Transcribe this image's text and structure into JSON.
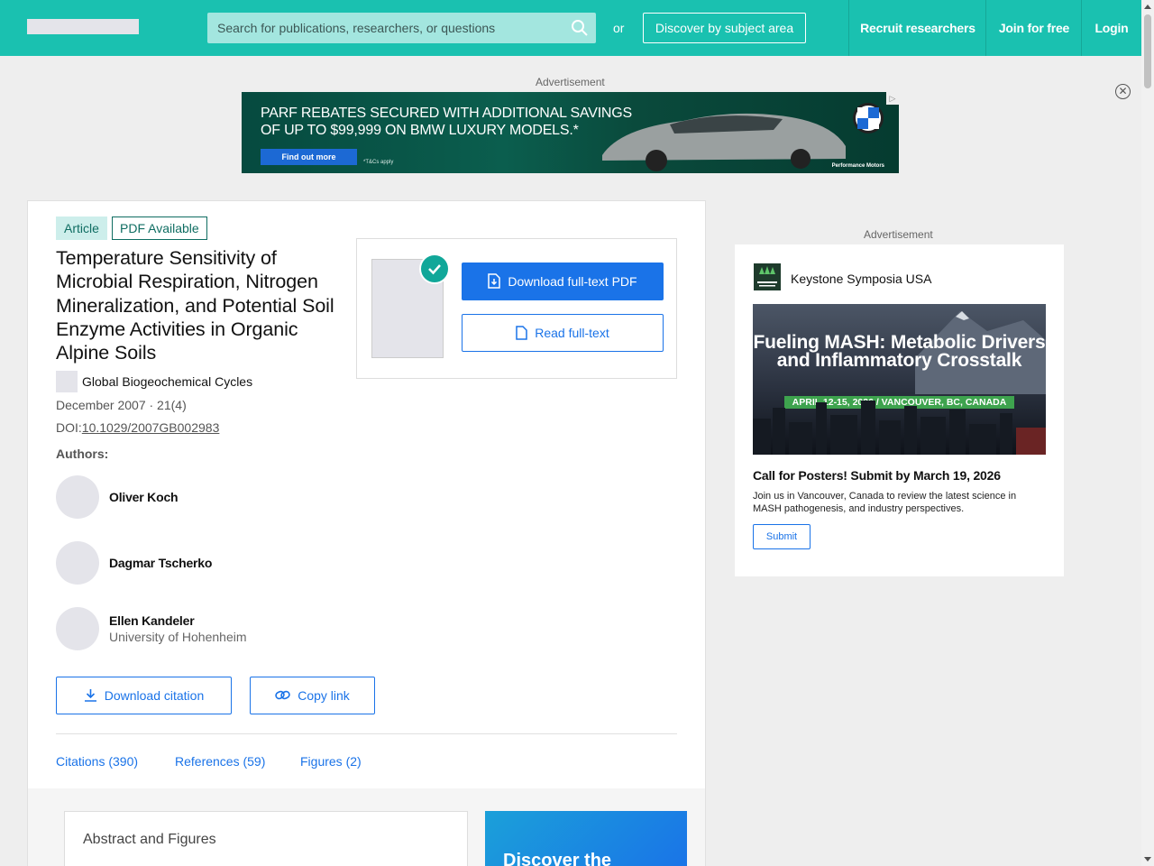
{
  "header": {
    "search_placeholder": "Search for publications, researchers, or questions",
    "or_label": "or",
    "discover_label": "Discover by subject area",
    "recruit_label": "Recruit researchers",
    "join_label": "Join for free",
    "login_label": "Login"
  },
  "top_ad": {
    "label": "Advertisement",
    "headline": "PARF REBATES SECURED WITH ADDITIONAL SAVINGS OF UP TO $99,999 ON BMW LUXURY MODELS.*",
    "cta": "Find out more",
    "tc": "*T&Cs apply",
    "dealer": "Performance Motors"
  },
  "article": {
    "badge_type": "Article",
    "badge_pdf": "PDF Available",
    "title": "Temperature Sensitivity of Microbial Respiration, Nitrogen Mineralization, and Potential Soil Enzyme Activities in Organic Alpine Soils",
    "journal": "Global Biogeochemical Cycles",
    "date_issue": "December 2007 · 21(4)",
    "doi_prefix": "DOI:",
    "doi": "10.1029/2007GB002983",
    "authors_label": "Authors:",
    "authors": [
      {
        "name": "Oliver Koch",
        "affiliation": ""
      },
      {
        "name": "Dagmar Tscherko",
        "affiliation": ""
      },
      {
        "name": "Ellen Kandeler",
        "affiliation": "University of Hohenheim"
      }
    ],
    "download_pdf_label": "Download full-text PDF",
    "read_fulltext_label": "Read full-text",
    "download_citation_label": "Download citation",
    "copy_link_label": "Copy link",
    "tabs": [
      {
        "label": "Citations (390)"
      },
      {
        "label": "References (59)"
      },
      {
        "label": "Figures (2)"
      }
    ],
    "abstract_title": "Abstract and Figures",
    "promo_text": "Discover the"
  },
  "right_ad": {
    "label": "Advertisement",
    "sponsor": "Keystone Symposia USA",
    "image_title": "Fueling MASH: Metabolic Drivers and Inflammatory Crosstalk",
    "image_strip": "APRIL 12-15, 2026 / VANCOUVER, BC, CANADA",
    "headline": "Call for Posters! Submit by March 19, 2026",
    "body": "Join us in Vancouver, Canada to review the latest science in MASH pathogenesis, and industry perspectives.",
    "cta": "Submit"
  },
  "colors": {
    "brand_teal": "#1ac1b0",
    "link_blue": "#1a73e8"
  }
}
